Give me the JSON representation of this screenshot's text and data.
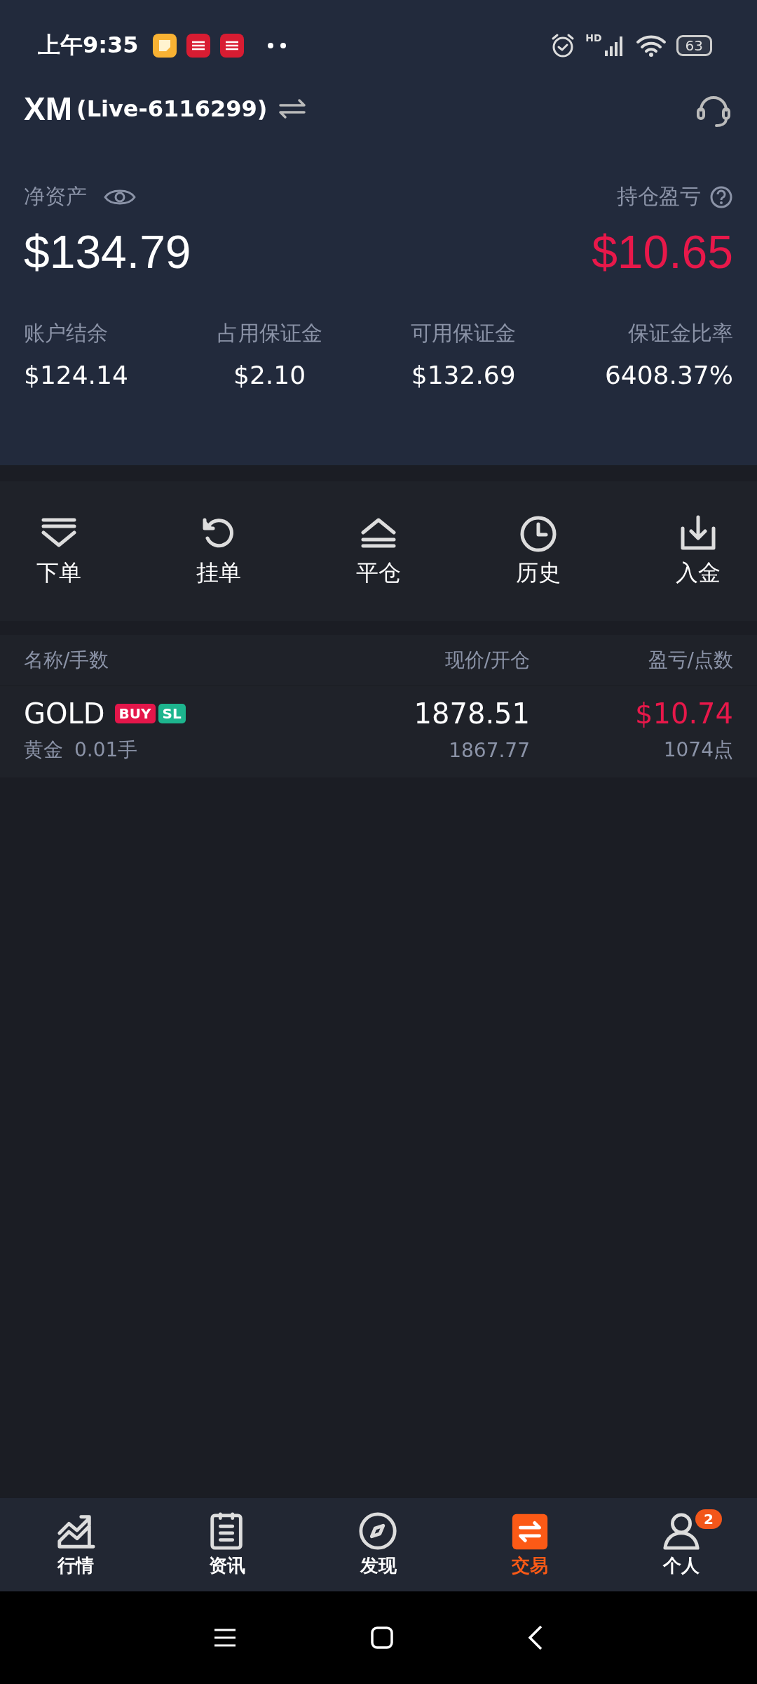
{
  "status_bar": {
    "time": "上午9:35",
    "network": "HD",
    "battery": "63"
  },
  "header": {
    "brand": "XM",
    "account": "(Live-6116299)"
  },
  "summary": {
    "equity": {
      "label": "净资产",
      "value": "$134.79"
    },
    "pnl": {
      "label": "持仓盈亏",
      "value": "$10.65"
    },
    "stats": [
      {
        "label": "账户结余",
        "value": "$124.14"
      },
      {
        "label": "占用保证金",
        "value": "$2.10"
      },
      {
        "label": "可用保证金",
        "value": "$132.69"
      },
      {
        "label": "保证金比率",
        "value": "6408.37%"
      }
    ]
  },
  "actions": [
    {
      "kind": "order",
      "label": "下单"
    },
    {
      "kind": "pending",
      "label": "挂单"
    },
    {
      "kind": "close",
      "label": "平仓"
    },
    {
      "kind": "history",
      "label": "历史"
    },
    {
      "kind": "deposit",
      "label": "入金"
    }
  ],
  "positions": {
    "columns": [
      "名称/手数",
      "现价/开仓",
      "盈亏/点数"
    ],
    "rows": [
      {
        "symbol": "GOLD",
        "tags": [
          {
            "text": "BUY",
            "color": "#e4164a"
          },
          {
            "text": "SL",
            "color": "#1db58e"
          }
        ],
        "name": "黄金",
        "lots": "0.01手",
        "price": "1878.51",
        "open": "1867.77",
        "pnl": "$10.74",
        "points": "1074点"
      }
    ]
  },
  "nav": [
    {
      "kind": "markets",
      "label": "行情",
      "selected": false
    },
    {
      "kind": "news",
      "label": "资讯",
      "selected": false
    },
    {
      "kind": "discover",
      "label": "发现",
      "selected": false
    },
    {
      "kind": "trade",
      "label": "交易",
      "selected": true
    },
    {
      "kind": "profile",
      "label": "个人",
      "selected": false,
      "badge": "2"
    }
  ]
}
